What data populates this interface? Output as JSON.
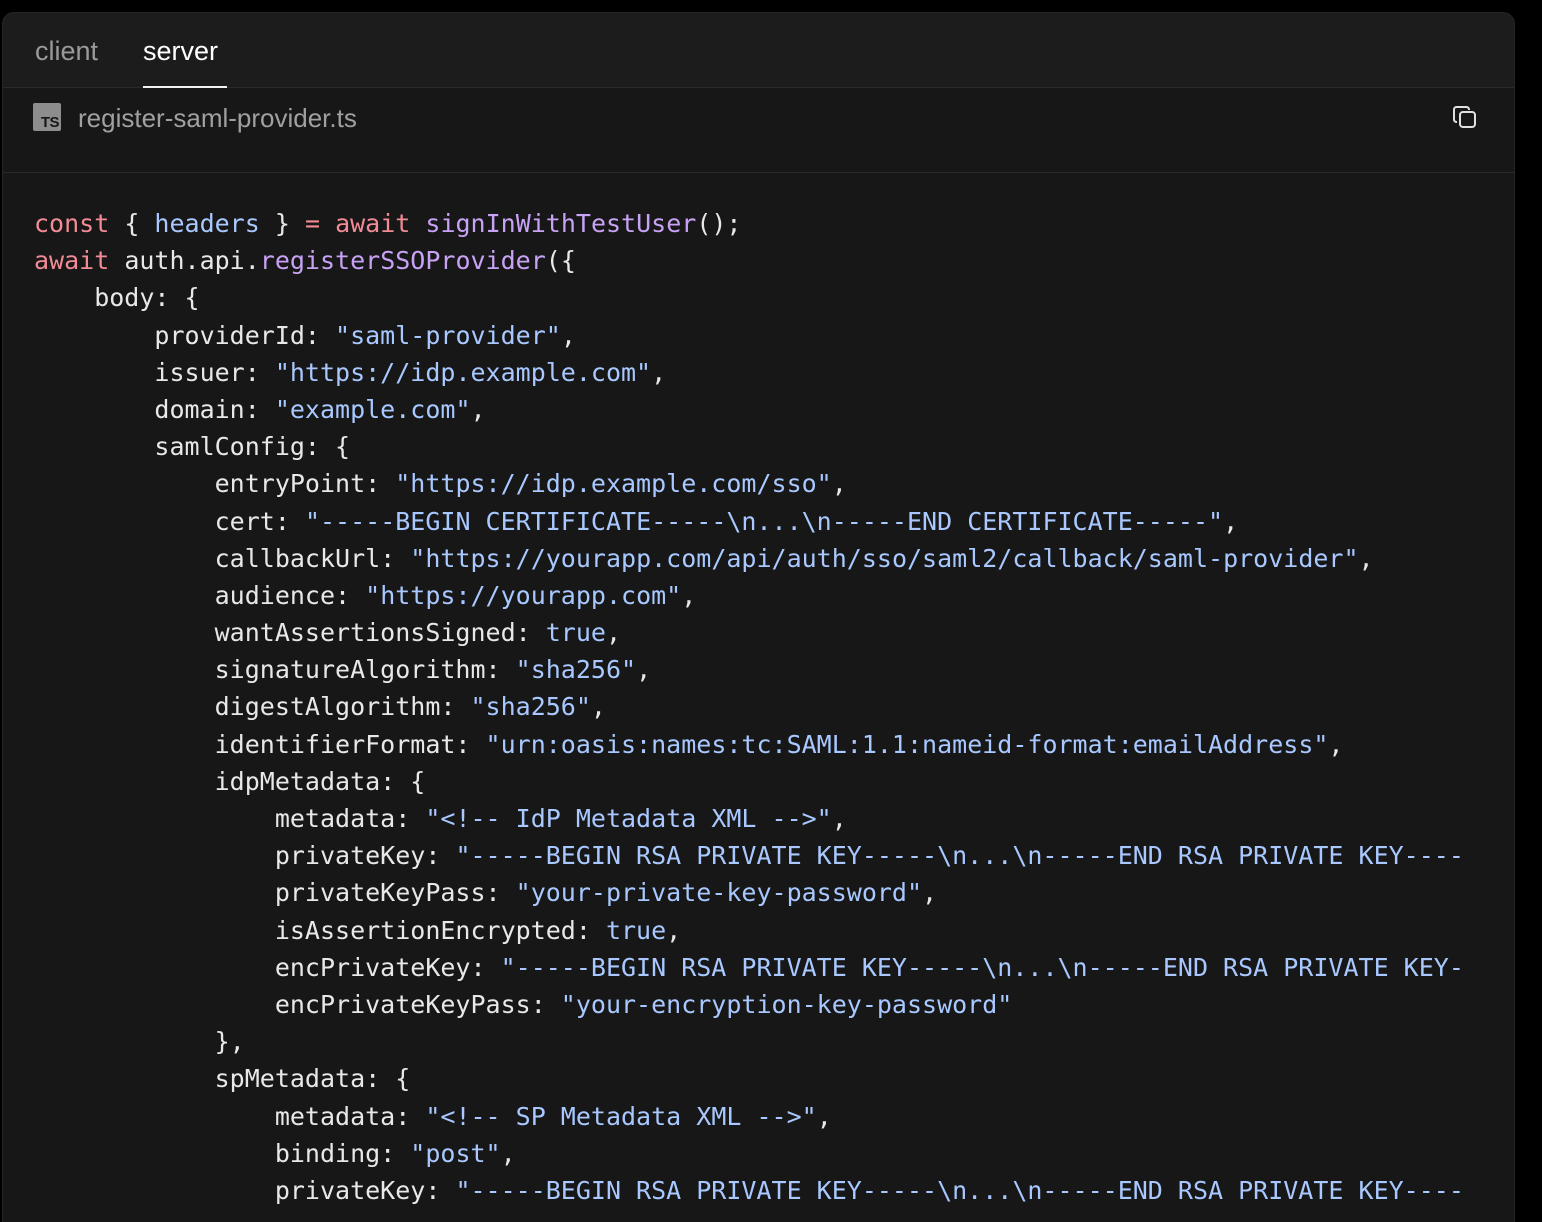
{
  "tabs": [
    {
      "label": "client",
      "active": false
    },
    {
      "label": "server",
      "active": true
    }
  ],
  "file": {
    "icon_label": "TS",
    "name": "register-saml-provider.ts",
    "copy_icon": "copy-icon"
  },
  "colors": {
    "background": "#171717",
    "keyword": "#f28b95",
    "function": "#c8a2f5",
    "string": "#a8c8ff",
    "plain": "#e8e8e8"
  },
  "code_lines": [
    [
      {
        "t": "const",
        "c": "kw"
      },
      {
        "t": " { ",
        "c": "pl"
      },
      {
        "t": "headers",
        "c": "var"
      },
      {
        "t": " } ",
        "c": "pl"
      },
      {
        "t": "=",
        "c": "kw"
      },
      {
        "t": " ",
        "c": "pl"
      },
      {
        "t": "await",
        "c": "kw"
      },
      {
        "t": " ",
        "c": "pl"
      },
      {
        "t": "signInWithTestUser",
        "c": "fn"
      },
      {
        "t": "();",
        "c": "pl"
      }
    ],
    [
      {
        "t": "await",
        "c": "kw"
      },
      {
        "t": " auth.api.",
        "c": "pl"
      },
      {
        "t": "registerSSOProvider",
        "c": "fn"
      },
      {
        "t": "({",
        "c": "pl"
      }
    ],
    [
      {
        "t": "    body: {",
        "c": "pl"
      }
    ],
    [
      {
        "t": "        providerId: ",
        "c": "pl"
      },
      {
        "t": "\"saml-provider\"",
        "c": "str"
      },
      {
        "t": ",",
        "c": "pl"
      }
    ],
    [
      {
        "t": "        issuer: ",
        "c": "pl"
      },
      {
        "t": "\"https://idp.example.com\"",
        "c": "str"
      },
      {
        "t": ",",
        "c": "pl"
      }
    ],
    [
      {
        "t": "        domain: ",
        "c": "pl"
      },
      {
        "t": "\"example.com\"",
        "c": "str"
      },
      {
        "t": ",",
        "c": "pl"
      }
    ],
    [
      {
        "t": "        samlConfig: {",
        "c": "pl"
      }
    ],
    [
      {
        "t": "            entryPoint: ",
        "c": "pl"
      },
      {
        "t": "\"https://idp.example.com/sso\"",
        "c": "str"
      },
      {
        "t": ",",
        "c": "pl"
      }
    ],
    [
      {
        "t": "            cert: ",
        "c": "pl"
      },
      {
        "t": "\"-----BEGIN CERTIFICATE-----\\n...\\n-----END CERTIFICATE-----\"",
        "c": "str"
      },
      {
        "t": ",",
        "c": "pl"
      }
    ],
    [
      {
        "t": "            callbackUrl: ",
        "c": "pl"
      },
      {
        "t": "\"https://yourapp.com/api/auth/sso/saml2/callback/saml-provider\"",
        "c": "str"
      },
      {
        "t": ",",
        "c": "pl"
      }
    ],
    [
      {
        "t": "            audience: ",
        "c": "pl"
      },
      {
        "t": "\"https://yourapp.com\"",
        "c": "str"
      },
      {
        "t": ",",
        "c": "pl"
      }
    ],
    [
      {
        "t": "            wantAssertionsSigned: ",
        "c": "pl"
      },
      {
        "t": "true",
        "c": "lit"
      },
      {
        "t": ",",
        "c": "pl"
      }
    ],
    [
      {
        "t": "            signatureAlgorithm: ",
        "c": "pl"
      },
      {
        "t": "\"sha256\"",
        "c": "str"
      },
      {
        "t": ",",
        "c": "pl"
      }
    ],
    [
      {
        "t": "            digestAlgorithm: ",
        "c": "pl"
      },
      {
        "t": "\"sha256\"",
        "c": "str"
      },
      {
        "t": ",",
        "c": "pl"
      }
    ],
    [
      {
        "t": "            identifierFormat: ",
        "c": "pl"
      },
      {
        "t": "\"urn:oasis:names:tc:SAML:1.1:nameid-format:emailAddress\"",
        "c": "str"
      },
      {
        "t": ",",
        "c": "pl"
      }
    ],
    [
      {
        "t": "            idpMetadata: {",
        "c": "pl"
      }
    ],
    [
      {
        "t": "                metadata: ",
        "c": "pl"
      },
      {
        "t": "\"<!-- IdP Metadata XML -->\"",
        "c": "str"
      },
      {
        "t": ",",
        "c": "pl"
      }
    ],
    [
      {
        "t": "                privateKey: ",
        "c": "pl"
      },
      {
        "t": "\"-----BEGIN RSA PRIVATE KEY-----\\n...\\n-----END RSA PRIVATE KEY----",
        "c": "str"
      }
    ],
    [
      {
        "t": "                privateKeyPass: ",
        "c": "pl"
      },
      {
        "t": "\"your-private-key-password\"",
        "c": "str"
      },
      {
        "t": ",",
        "c": "pl"
      }
    ],
    [
      {
        "t": "                isAssertionEncrypted: ",
        "c": "pl"
      },
      {
        "t": "true",
        "c": "lit"
      },
      {
        "t": ",",
        "c": "pl"
      }
    ],
    [
      {
        "t": "                encPrivateKey: ",
        "c": "pl"
      },
      {
        "t": "\"-----BEGIN RSA PRIVATE KEY-----\\n...\\n-----END RSA PRIVATE KEY-",
        "c": "str"
      }
    ],
    [
      {
        "t": "                encPrivateKeyPass: ",
        "c": "pl"
      },
      {
        "t": "\"your-encryption-key-password\"",
        "c": "str"
      }
    ],
    [
      {
        "t": "            },",
        "c": "pl"
      }
    ],
    [
      {
        "t": "            spMetadata: {",
        "c": "pl"
      }
    ],
    [
      {
        "t": "                metadata: ",
        "c": "pl"
      },
      {
        "t": "\"<!-- SP Metadata XML -->\"",
        "c": "str"
      },
      {
        "t": ",",
        "c": "pl"
      }
    ],
    [
      {
        "t": "                binding: ",
        "c": "pl"
      },
      {
        "t": "\"post\"",
        "c": "str"
      },
      {
        "t": ",",
        "c": "pl"
      }
    ],
    [
      {
        "t": "                privateKey: ",
        "c": "pl"
      },
      {
        "t": "\"-----BEGIN RSA PRIVATE KEY-----\\n...\\n-----END RSA PRIVATE KEY----",
        "c": "str"
      }
    ]
  ]
}
